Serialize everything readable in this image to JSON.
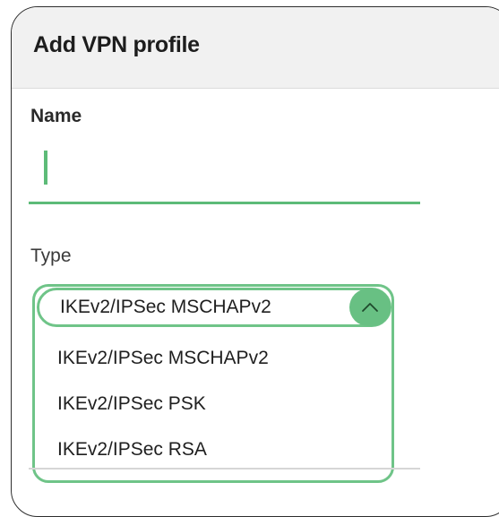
{
  "dialog": {
    "title": "Add VPN profile"
  },
  "name_field": {
    "label": "Name",
    "value": ""
  },
  "type_field": {
    "label": "Type",
    "selected": "IKEv2/IPSec MSCHAPv2",
    "options": [
      "IKEv2/IPSec MSCHAPv2",
      "IKEv2/IPSec PSK",
      "IKEv2/IPSec RSA"
    ],
    "icon": "chevron-up-icon"
  },
  "colors": {
    "accent": "#5dbb78",
    "header_bg": "#f1f1f1"
  }
}
